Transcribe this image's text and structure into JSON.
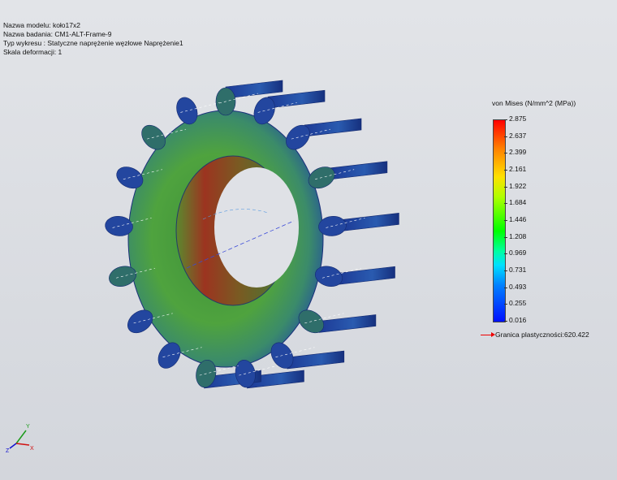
{
  "info": {
    "model_name": "Nazwa modelu: koło17x2",
    "study_name": "Nazwa badania: CM1-ALT-Frame-9",
    "plot_type": "Typ wykresu : Statyczne naprężenie węzłowe Naprężenie1",
    "deformation_scale": "Skala deformacji: 1"
  },
  "legend": {
    "title": "von Mises (N/mm^2 (MPa))",
    "ticks": [
      "2.875",
      "2.637",
      "2.399",
      "2.161",
      "1.922",
      "1.684",
      "1.446",
      "1.208",
      "0.969",
      "0.731",
      "0.493",
      "0.255",
      "0.016"
    ],
    "yield_label": "Granica plastyczności:620.422",
    "yield_color": "#e00000"
  },
  "colors": {
    "gear_blue": "#1e3f9e",
    "gear_green": "#3aa14a",
    "bore_red": "#a52a1a"
  },
  "triad": {
    "x_label": "X",
    "y_label": "Y",
    "z_label": "Z"
  }
}
